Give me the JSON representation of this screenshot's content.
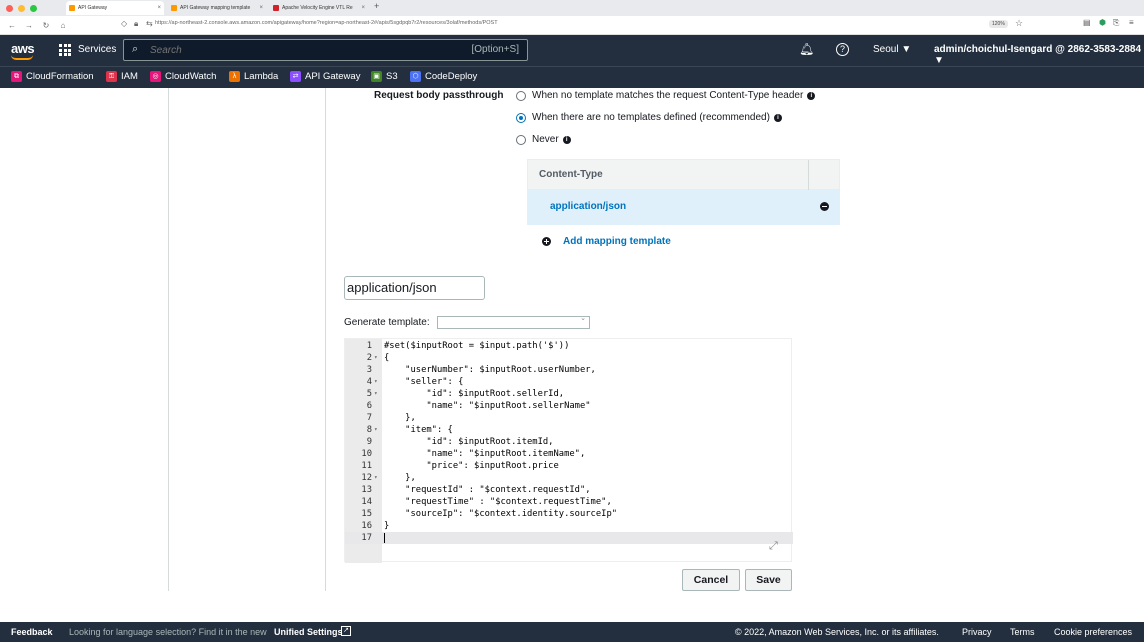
{
  "browser": {
    "tabs": [
      {
        "title": "API Gateway",
        "active": true
      },
      {
        "title": "API Gateway mapping template",
        "active": false
      },
      {
        "title": "Apache Velocity Engine VTL Re",
        "active": false
      }
    ],
    "url": "https://ap-northeast-2.console.aws.amazon.com/apigateway/home?region=ap-northeast-2#/apis/5sgdpqb7r2/resources/3olaf/methods/POST",
    "zoom": "120%"
  },
  "aws_nav": {
    "logo": "aws",
    "services_label": "Services",
    "search_placeholder": "Search",
    "search_shortcut": "[Option+S]",
    "region": "Seoul ▼",
    "account": "admin/choichul-Isengard @ 2862-3583-2884 ▼"
  },
  "favorites": [
    {
      "label": "CloudFormation",
      "color": "#e7157b"
    },
    {
      "label": "IAM",
      "color": "#dd344c"
    },
    {
      "label": "CloudWatch",
      "color": "#e7157b"
    },
    {
      "label": "Lambda",
      "color": "#ed7100"
    },
    {
      "label": "API Gateway",
      "color": "#8c4fff"
    },
    {
      "label": "S3",
      "color": "#3f8624"
    },
    {
      "label": "CodeDeploy",
      "color": "#4d72f3"
    }
  ],
  "passthrough": {
    "label": "Request body passthrough",
    "options": [
      {
        "label": "When no template matches the request Content-Type header",
        "selected": false
      },
      {
        "label": "When there are no templates defined (recommended)",
        "selected": true
      },
      {
        "label": "Never",
        "selected": false
      }
    ]
  },
  "content_type_table": {
    "header": "Content-Type",
    "rows": [
      "application/json"
    ],
    "add_label": "Add mapping template"
  },
  "template": {
    "content_type_value": "application/json",
    "generate_label": "Generate template:",
    "generate_value": "",
    "lines": [
      {
        "n": "1",
        "fold": "",
        "code": "#set($inputRoot = $input.path('$'))"
      },
      {
        "n": "2",
        "fold": "▾",
        "code": "{"
      },
      {
        "n": "3",
        "fold": "",
        "code": "    \"userNumber\": $inputRoot.userNumber,"
      },
      {
        "n": "4",
        "fold": "▾",
        "code": "    \"seller\": {"
      },
      {
        "n": "5",
        "fold": "▾",
        "code": "        \"id\": $inputRoot.sellerId,"
      },
      {
        "n": "6",
        "fold": "",
        "code": "        \"name\": \"$inputRoot.sellerName\""
      },
      {
        "n": "7",
        "fold": "",
        "code": "    },"
      },
      {
        "n": "8",
        "fold": "▾",
        "code": "    \"item\": {"
      },
      {
        "n": "9",
        "fold": "",
        "code": "        \"id\": $inputRoot.itemId,"
      },
      {
        "n": "10",
        "fold": "",
        "code": "        \"name\": \"$inputRoot.itemName\","
      },
      {
        "n": "11",
        "fold": "",
        "code": "        \"price\": $inputRoot.price"
      },
      {
        "n": "12",
        "fold": "▾",
        "code": "    },"
      },
      {
        "n": "13",
        "fold": "",
        "code": "    \"requestId\" : \"$context.requestId\","
      },
      {
        "n": "14",
        "fold": "",
        "code": "    \"requestTime\" : \"$context.requestTime\","
      },
      {
        "n": "15",
        "fold": "",
        "code": "    \"sourceIp\": \"$context.identity.sourceIp\""
      },
      {
        "n": "16",
        "fold": "",
        "code": "}"
      },
      {
        "n": "17",
        "fold": "",
        "code": ""
      }
    ]
  },
  "actions": {
    "cancel": "Cancel",
    "save": "Save"
  },
  "footer": {
    "feedback": "Feedback",
    "language_text": "Looking for language selection? Find it in the new",
    "unified_settings": "Unified Settings",
    "copyright": "© 2022, Amazon Web Services, Inc. or its affiliates.",
    "privacy": "Privacy",
    "terms": "Terms",
    "cookies": "Cookie preferences"
  }
}
